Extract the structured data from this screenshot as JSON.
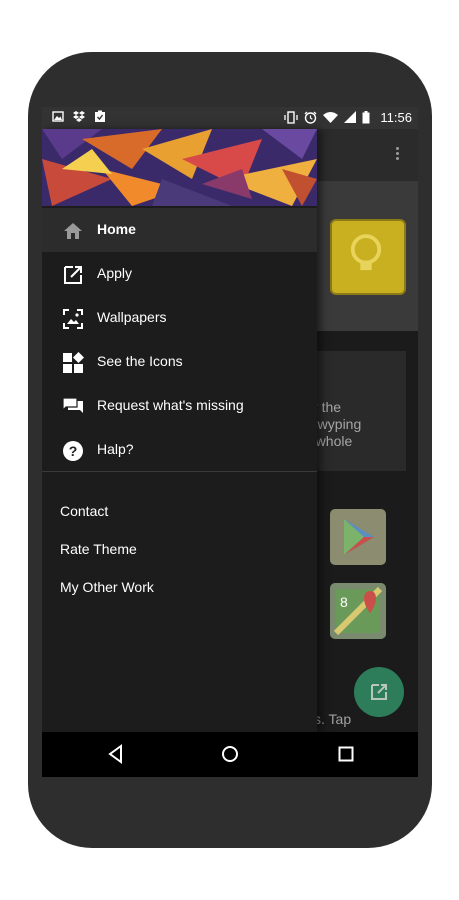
{
  "status_bar": {
    "left_icons": [
      "image-icon",
      "dropbox-icon",
      "clipboard-check-icon"
    ],
    "right_icons": [
      "vibrate-icon",
      "alarm-icon",
      "wifi-icon",
      "signal-icon",
      "battery-icon"
    ],
    "time": "11:56"
  },
  "app_background": {
    "card_lines": [
      "pply the",
      "by swyping",
      "a whole"
    ],
    "bottom_text": "s. Tap",
    "fab_icon": "open-external-icon"
  },
  "drawer": {
    "primary_items": [
      {
        "label": "Home",
        "icon": "home-icon",
        "active": true
      },
      {
        "label": "Apply",
        "icon": "open-external-icon",
        "active": false
      },
      {
        "label": "Wallpapers",
        "icon": "wallpaper-icon",
        "active": false
      },
      {
        "label": "See the Icons",
        "icon": "widgets-icon",
        "active": false
      },
      {
        "label": "Request what's missing",
        "icon": "chat-icon",
        "active": false
      },
      {
        "label": "Halp?",
        "icon": "help-icon",
        "active": false
      }
    ],
    "secondary_items": [
      {
        "label": "Contact"
      },
      {
        "label": "Rate Theme"
      },
      {
        "label": "My Other Work"
      }
    ]
  },
  "nav_bar": {
    "buttons": [
      "back-icon",
      "home-circle-icon",
      "recents-icon"
    ]
  },
  "colors": {
    "phone_body": "#2e2e2e",
    "drawer_bg": "#1c1c1c",
    "active_item_bg": "#2c2c2c",
    "fab": "#2e7d5a"
  }
}
